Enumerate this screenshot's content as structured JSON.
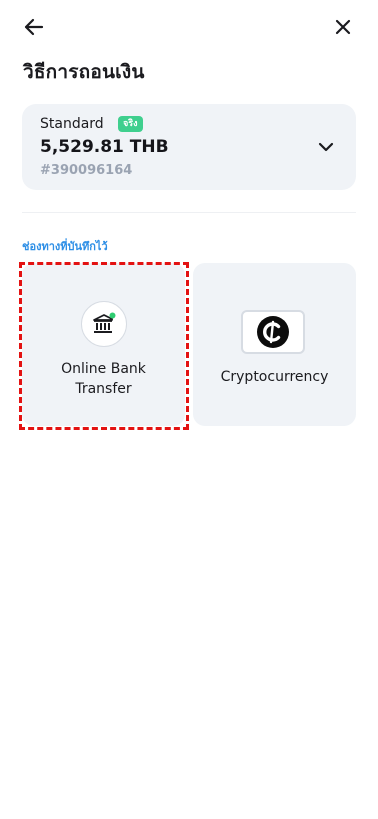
{
  "header": {
    "back_icon": "arrow-left-icon",
    "close_icon": "close-icon",
    "title": "วิธีการถอนเงิน"
  },
  "account": {
    "type": "Standard",
    "badge": "จริง",
    "badge_color": "#3fcf8e",
    "balance": "5,529.81 THB",
    "number": "#390096164",
    "dropdown_icon": "chevron-down-icon"
  },
  "saved_methods": {
    "label": "ช่องทางที่บันทึกไว้",
    "label_color": "#2e8fe6",
    "items": [
      {
        "label_line1": "Online Bank",
        "label_line2": "Transfer",
        "icon": "bank-icon",
        "selected": true
      },
      {
        "label": "Cryptocurrency",
        "icon": "crypto-coin-icon",
        "selected": false
      }
    ]
  },
  "colors": {
    "card_bg": "#f0f3f7",
    "selection_outline": "#e31212",
    "status_dot": "#2ecc71"
  }
}
